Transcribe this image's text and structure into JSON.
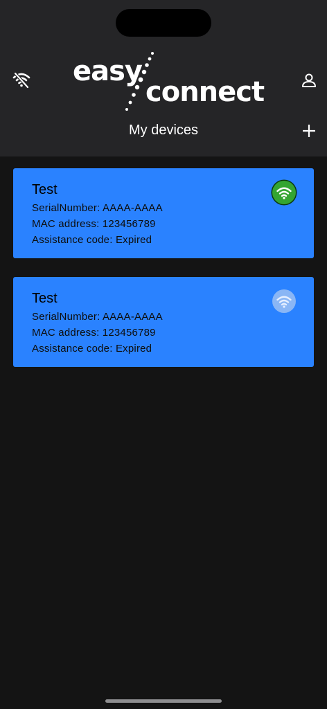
{
  "header": {
    "logo_text_1": "easy",
    "logo_text_2": "connect",
    "title": "My devices"
  },
  "icons": {
    "connection_status": "wifi-off-icon",
    "account": "user-icon",
    "add": "plus-icon"
  },
  "devices": [
    {
      "name": "Test",
      "serial": "SerialNumber: AAAA-AAAA",
      "mac": "MAC address: 123456789",
      "assistance": "Assistance code: Expired",
      "status": "online",
      "status_color": "#34a532"
    },
    {
      "name": "Test",
      "serial": "SerialNumber: AAAA-AAAA",
      "mac": "MAC address: 123456789",
      "assistance": "Assistance code: Expired",
      "status": "offline",
      "status_color": "#8ab6f5"
    }
  ],
  "colors": {
    "header_bg": "#252527",
    "page_bg": "#141414",
    "card_bg": "#2a82ff"
  }
}
